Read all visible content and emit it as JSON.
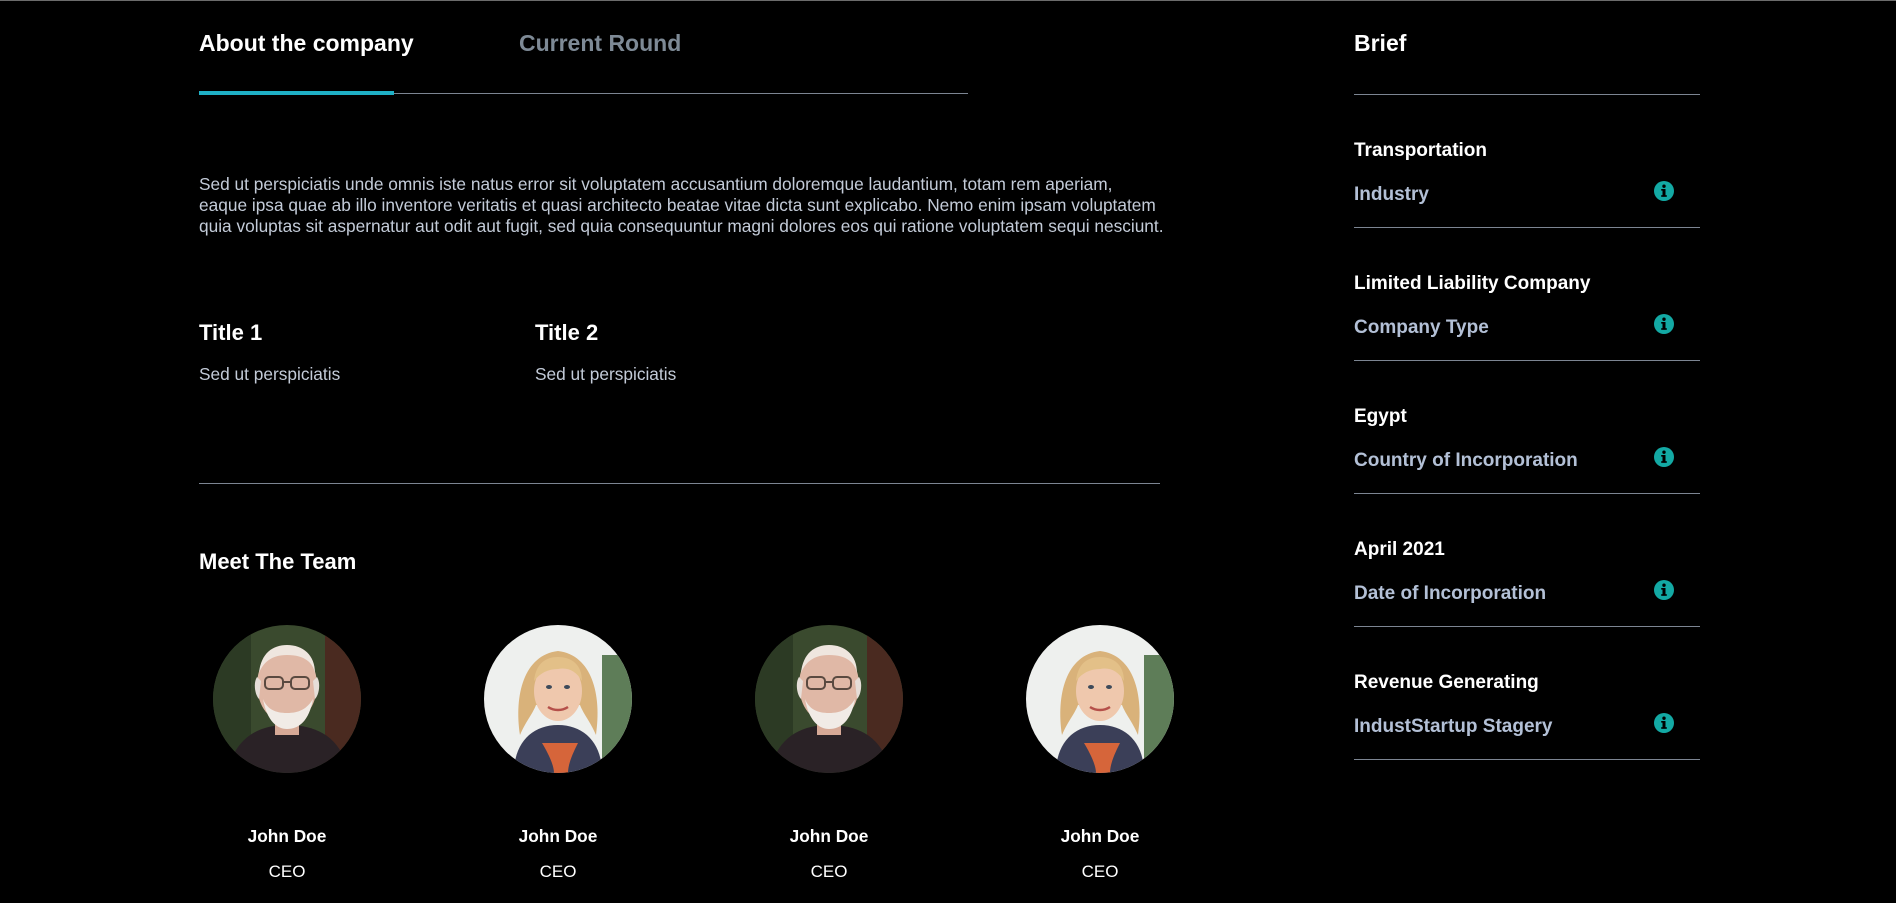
{
  "tabs": [
    {
      "label": "About the company",
      "active": true
    },
    {
      "label": "Current Round",
      "active": false
    }
  ],
  "about": {
    "description": "Sed ut perspiciatis unde omnis iste natus error sit voluptatem accusantium doloremque laudantium, totam rem aperiam, eaque ipsa quae ab illo inventore veritatis et quasi architecto beatae vitae dicta sunt explicabo. Nemo enim ipsam voluptatem quia voluptas sit aspernatur aut odit aut fugit, sed quia consequuntur magni dolores eos qui ratione voluptatem sequi nesciunt.",
    "titles": [
      {
        "title": "Title 1",
        "subtitle": "Sed ut perspiciatis"
      },
      {
        "title": "Title 2",
        "subtitle": "Sed ut perspiciatis"
      }
    ]
  },
  "team": {
    "heading": "Meet The Team",
    "members": [
      {
        "name": "John Doe",
        "role": "CEO",
        "photo": "older-man-portrait"
      },
      {
        "name": "John Doe",
        "role": "CEO",
        "photo": "blonde-woman-portrait"
      },
      {
        "name": "John Doe",
        "role": "CEO",
        "photo": "older-man-portrait"
      },
      {
        "name": "John Doe",
        "role": "CEO",
        "photo": "blonde-woman-portrait"
      }
    ]
  },
  "brief": {
    "title": "Brief",
    "items": [
      {
        "value": "Transportation",
        "label": "Industry",
        "icon": "info-icon"
      },
      {
        "value": "Limited Liability Company",
        "label": "Company Type",
        "icon": "info-icon"
      },
      {
        "value": "Egypt",
        "label": "Country of Incorporation",
        "icon": "info-icon"
      },
      {
        "value": "April 2021",
        "label": "Date of Incorporation",
        "icon": "info-icon"
      },
      {
        "value": "Revenue Generating",
        "label": "IndustStartup Stagery",
        "icon": "info-icon"
      }
    ]
  },
  "colors": {
    "background": "#000000",
    "accent": "#1fb0c6",
    "info_icon": "#13a9a4",
    "muted_text": "#c3cbd8",
    "label_text": "#b3c0d6",
    "inactive_tab": "#7e8a96",
    "divider": "#7c8592"
  }
}
